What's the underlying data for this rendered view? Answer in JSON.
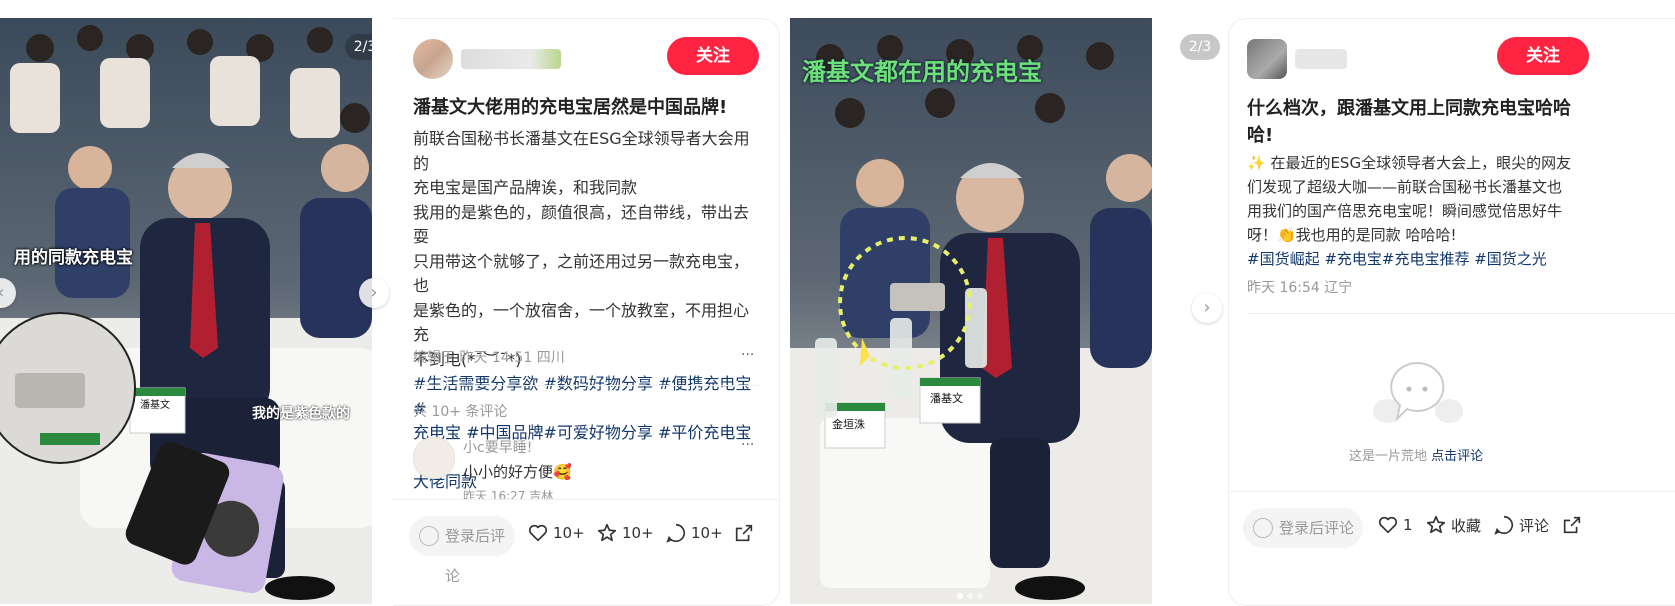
{
  "post1": {
    "pager": "2/3",
    "image_overlay_caption": "用的同款充电宝",
    "image_handwritten": "我的是紫色款的",
    "nameplate": "潘基文",
    "follow_label": "关注",
    "title": "潘基文大佬用的充电宝居然是中国品牌!",
    "desc_lines": [
      "前联合国秘书长潘基文在ESG全球领导者大会用的",
      "充电宝是国产品牌诶，和我同款",
      "我用的是紫色的，颜值很高，还自带线，带出去耍",
      "只用带这个就够了，之前还用过另一款充电宝，也",
      "是紫色的，一个放宿舍，一个放教室，不用担心充",
      "不到电(*ˉ︶ˉ*)"
    ],
    "tag_lines": [
      "#生活需要分享欲 #数码好物分享 #便携充电宝 #",
      "充电宝 #中国品牌#可爱好物分享 #平价充电宝 #",
      "大佬同款"
    ],
    "meta": "编辑于 昨天 14:51 四川",
    "more": "···",
    "comments_count": "共 10+ 条评论",
    "comment": {
      "author": "小c要早睡!",
      "text": "小小的好方便🥰",
      "time": "昨天 16:27 吉林"
    },
    "bottom": {
      "input_placeholder": "登录后评论",
      "likes": "10+",
      "collects": "10+",
      "comments": "10+"
    }
  },
  "post2": {
    "pager": "2/3",
    "image_banner": "潘基文都在用的充电宝",
    "nameplates": [
      "金垣洙",
      "潘基文"
    ],
    "follow_label": "关注",
    "title_lines": [
      "什么档次，跟潘基文用上同款充电宝哈哈",
      "哈!"
    ],
    "desc_lines": [
      "✨ 在最近的ESG全球领导者大会上，眼尖的网友",
      "们发现了超级大咖——前联合国秘书长潘基文也",
      "用我们的国产倍思充电宝呢！瞬间感觉倍思好牛",
      "呀！👏我也用的是同款 哈哈哈!"
    ],
    "tag_line": "#国货崛起 #充电宝#充电宝推荐 #国货之光",
    "meta": "昨天 16:54 辽宁",
    "empty_text": "这是一片荒地",
    "empty_link": "点击评论",
    "bottom": {
      "input_placeholder": "登录后评论",
      "likes": "1",
      "collect_label": "收藏",
      "comment_label": "评论"
    }
  },
  "colors": {
    "accent": "#ff2442",
    "tag": "#13386c",
    "muted": "#999999"
  }
}
